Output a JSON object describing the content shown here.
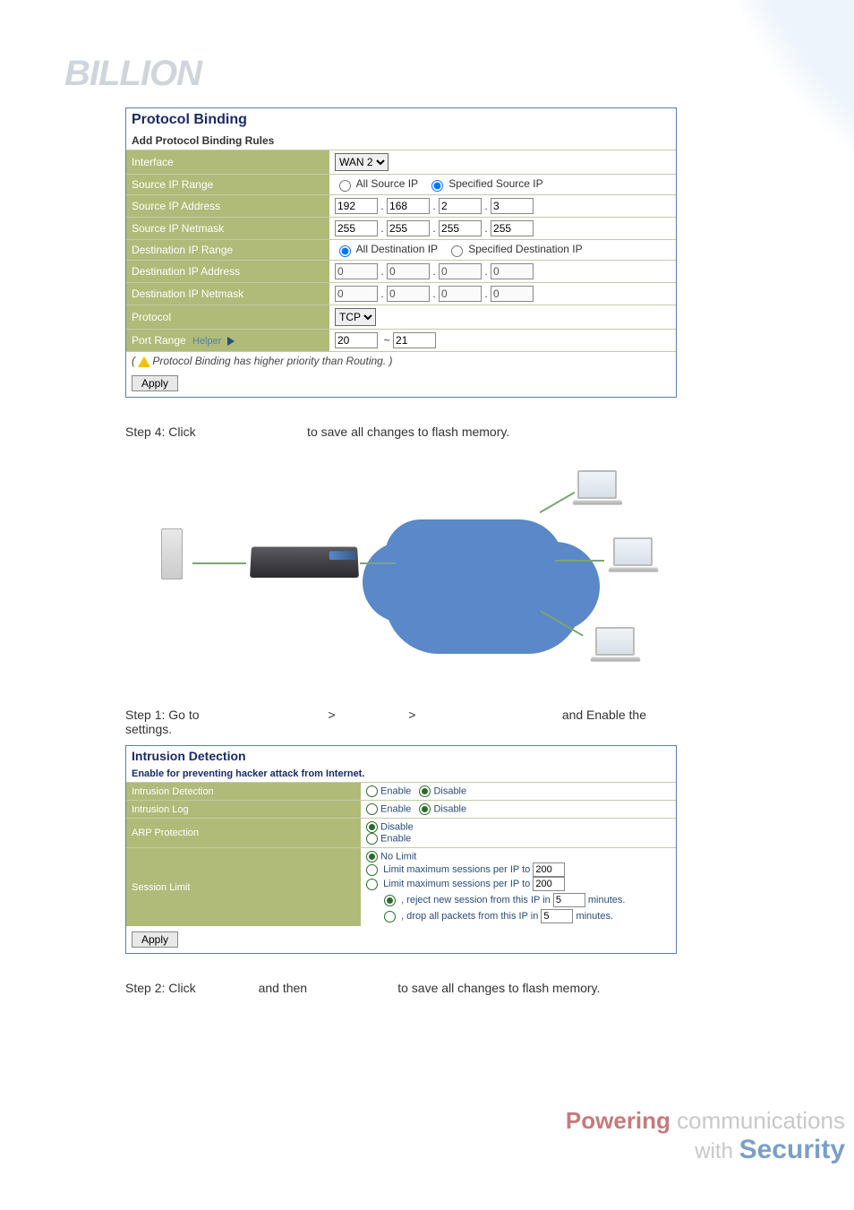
{
  "logo": "BILLION",
  "protocolBinding": {
    "title": "Protocol Binding",
    "subhead": "Add Protocol Binding Rules",
    "rows": {
      "interface": {
        "label": "Interface",
        "value": "WAN 2"
      },
      "srcRange": {
        "label": "Source IP Range",
        "opt1": "All Source IP",
        "opt2": "Specified Source IP"
      },
      "srcAddr": {
        "label": "Source IP Address",
        "v1": "192",
        "v2": "168",
        "v3": "2",
        "v4": "3"
      },
      "srcMask": {
        "label": "Source IP Netmask",
        "v1": "255",
        "v2": "255",
        "v3": "255",
        "v4": "255"
      },
      "dstRange": {
        "label": "Destination IP Range",
        "opt1": "All Destination IP",
        "opt2": "Specified Destination IP"
      },
      "dstAddr": {
        "label": "Destination IP Address",
        "v1": "0",
        "v2": "0",
        "v3": "0",
        "v4": "0"
      },
      "dstMask": {
        "label": "Destination IP Netmask",
        "v1": "0",
        "v2": "0",
        "v3": "0",
        "v4": "0"
      },
      "protocol": {
        "label": "Protocol",
        "value": "TCP"
      },
      "portRange": {
        "label": "Port Range",
        "helper": "Helper",
        "from": "20",
        "to": "21"
      }
    },
    "note": "Protocol Binding has higher priority than Routing.",
    "apply": "Apply"
  },
  "step4": "Step 4: Click                                to save all changes to flash memory.",
  "step1": "Step 1: Go to                                     >                     >                                          and Enable the settings.",
  "intrusion": {
    "title": "Intrusion Detection",
    "subhead": "Enable for preventing hacker attack from Internet.",
    "rows": {
      "detection": {
        "label": "Intrusion Detection",
        "enable": "Enable",
        "disable": "Disable"
      },
      "log": {
        "label": "Intrusion Log",
        "enable": "Enable",
        "disable": "Disable"
      },
      "arp": {
        "label": "ARP Protection",
        "disable": "Disable",
        "enable": "Enable"
      },
      "session": {
        "label": "Session Limit",
        "noLimit": "No Limit",
        "limit1pre": "Limit maximum sessions per IP to",
        "limit1val": "200",
        "limit2pre": "Limit maximum sessions per IP to",
        "limit2val": "200",
        "rejectPre": ", reject new session from this IP in",
        "rejectVal": "5",
        "rejectSuf": "minutes.",
        "dropPre": ", drop all packets from this IP in",
        "dropVal": "5",
        "dropSuf": "minutes."
      }
    },
    "apply": "Apply"
  },
  "step2": "Step 2: Click                  and then                          to save all changes to flash memory.",
  "footer": {
    "powering": "Powering",
    "comm": " communications",
    "with": "with ",
    "security": "Security"
  }
}
